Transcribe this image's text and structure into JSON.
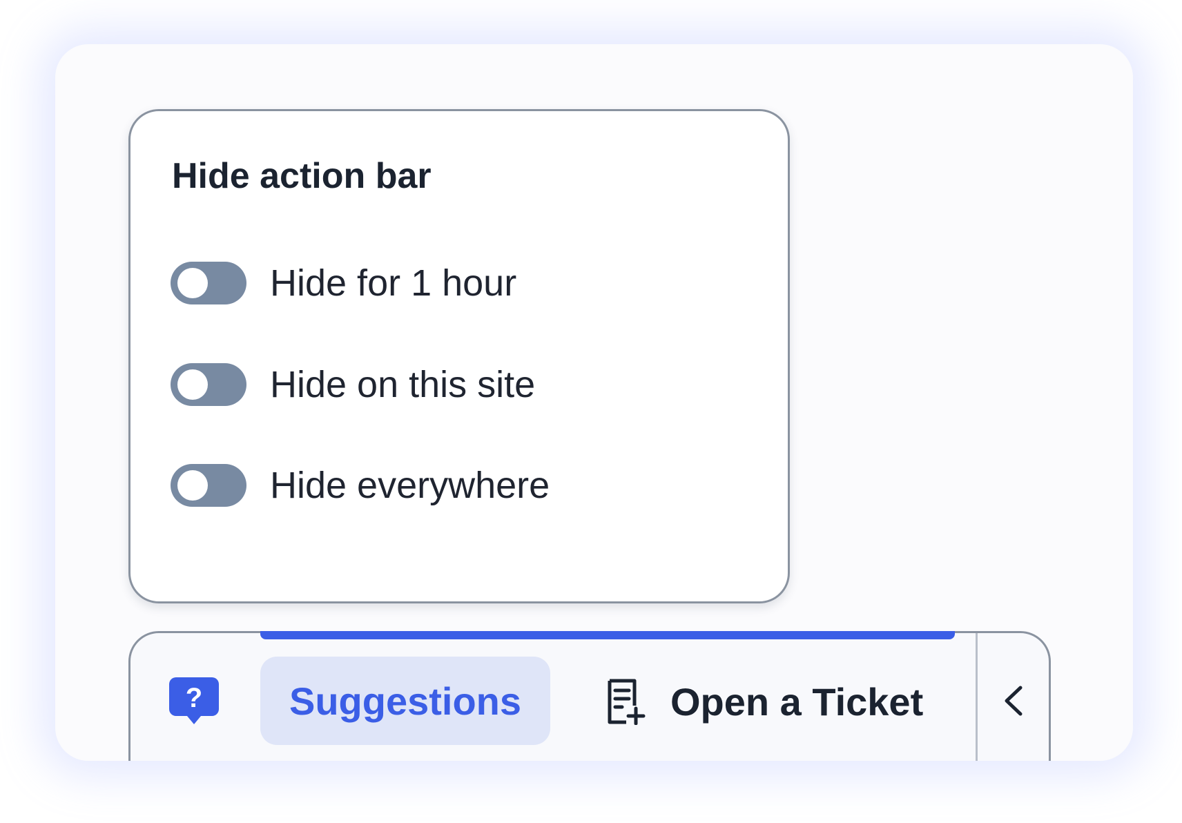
{
  "popover": {
    "title": "Hide action bar",
    "options": [
      {
        "label": "Hide for 1 hour",
        "enabled": false
      },
      {
        "label": "Hide on this site",
        "enabled": false
      },
      {
        "label": "Hide everywhere",
        "enabled": false
      }
    ]
  },
  "action_bar": {
    "help_icon": "help-chat-bubble-icon",
    "tabs": [
      {
        "label": "Suggestions",
        "selected": true
      }
    ],
    "open_ticket": {
      "label": "Open a Ticket",
      "icon": "add-document-icon"
    },
    "collapse_icon": "chevron-left-icon"
  },
  "colors": {
    "accent": "#3b5ee6",
    "tab_selected_bg": "#dfe5f8",
    "toggle_off": "#788aa2",
    "text_dark": "#1b2330",
    "border": "#8a93a0"
  }
}
